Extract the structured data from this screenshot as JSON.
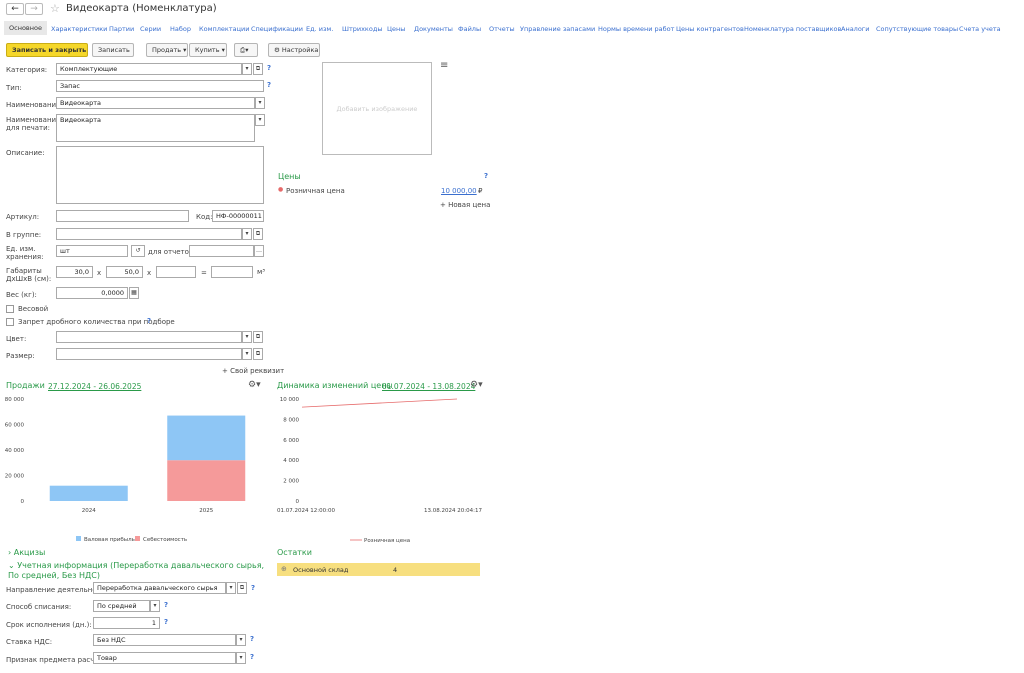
{
  "window": {
    "title": "Видеокарта (Номенклатура)"
  },
  "tabs": [
    "Основное",
    "Характеристики",
    "Партии",
    "Серии",
    "Набор",
    "Комплектации",
    "Спецификации",
    "Ед. изм.",
    "Штрихкоды",
    "Цены",
    "Документы",
    "Файлы",
    "Отчеты",
    "Управление запасами",
    "Нормы времени работ",
    "Цены контрагентов",
    "Номенклатура поставщиков",
    "Аналоги",
    "Сопутствующие товары",
    "Счета учета"
  ],
  "toolbar": {
    "save_close": "Записать и закрыть",
    "save": "Записать",
    "sell": "Продать",
    "buy": "Купить",
    "settings": "Настройка"
  },
  "form": {
    "category_label": "Категория:",
    "category": "Комплектующие",
    "type_label": "Тип:",
    "type": "Запас",
    "name_label": "Наименование:",
    "name": "Видеокарта",
    "print_name_label": "Наименование для печати:",
    "print_name": "Видеокарта",
    "description_label": "Описание:",
    "article_label": "Артикул:",
    "code_label": "Код:",
    "code": "НФ-00000011",
    "group_label": "В группе:",
    "unit_label": "Ед. изм. хранения:",
    "unit": "шт",
    "reports_label": "для отчетов:",
    "dims_label": "Габариты ДхШхВ (см):",
    "dim1": "30,0",
    "dim2": "50,0",
    "x": "x",
    "eq": "=",
    "m3": "м³",
    "weight_label": "Вес (кг):",
    "weight": "0,0000",
    "weighted_label": "Весовой",
    "fraction_label": "Запрет дробного количества при подборе",
    "color_label": "Цвет:",
    "size_label": "Размер:",
    "own_attr": "+ Свой реквизит"
  },
  "image": {
    "placeholder": "Добавить изображение"
  },
  "prices": {
    "title": "Цены",
    "item_label": "Розничная цена",
    "item_value": "10 000,00",
    "currency": "₽",
    "new_price": "+ Новая цена"
  },
  "sales_chart": {
    "title": "Продажи",
    "period": "27.12.2024 - 26.06.2025",
    "legend": [
      "Валовая прибыль",
      "Себестоимость"
    ],
    "colors": [
      "#8ec6f5",
      "#f59a9a"
    ]
  },
  "price_chart": {
    "title": "Динамика изменений цены",
    "period": "01.07.2024 - 13.08.2024",
    "legend": [
      "Розничная цена"
    ],
    "color": "#e66a6a"
  },
  "chart_data": [
    {
      "type": "bar",
      "title": "Продажи",
      "categories": [
        "2024",
        "2025"
      ],
      "series": [
        {
          "name": "Себестоимость",
          "values": [
            0,
            32000
          ]
        },
        {
          "name": "Валовая прибыль",
          "values": [
            12000,
            35000
          ]
        }
      ],
      "ylim": [
        0,
        80000
      ],
      "yticks": [
        "0",
        "20 000",
        "40 000",
        "60 000",
        "80 000"
      ],
      "stacked": true,
      "legend": "bottom"
    },
    {
      "type": "line",
      "title": "Динамика изменений цены",
      "x": [
        "01.07.2024 12:00:00",
        "13.08.2024 20:04:17"
      ],
      "series": [
        {
          "name": "Розничная цена",
          "values": [
            9200,
            10000
          ]
        }
      ],
      "ylim": [
        0,
        10000
      ],
      "yticks": [
        "0",
        "2 000",
        "4 000",
        "6 000",
        "8 000",
        "10 000"
      ],
      "legend": "bottom"
    }
  ],
  "excise": {
    "title": "Акцизы"
  },
  "accounting": {
    "title": "Учетная информация (Переработка давальческого сырья, По средней, Без НДС)",
    "activity_label": "Направление деятельности:",
    "activity": "Переработка давальческого сырья",
    "writeoff_label": "Способ списания:",
    "writeoff": "По средней",
    "term_label": "Срок исполнения (дн.):",
    "term": "1",
    "vat_label": "Ставка НДС:",
    "vat": "Без НДС",
    "sign_label": "Признак предмета расчета:",
    "sign": "Товар"
  },
  "stock": {
    "title": "Остатки",
    "warehouse": "Основной склад",
    "qty": "4"
  }
}
